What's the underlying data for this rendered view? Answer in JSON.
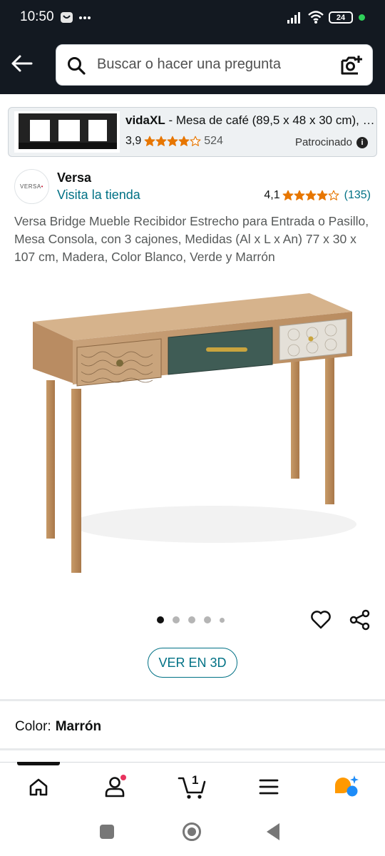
{
  "status_bar": {
    "time": "10:50",
    "battery": "24",
    "icons": [
      "notification-icon",
      "more-dots-icon",
      "signal-icon",
      "wifi-icon",
      "battery-icon",
      "status-dot-icon"
    ]
  },
  "search": {
    "placeholder": "Buscar o hacer una pregunta",
    "icons": [
      "back-arrow-icon",
      "search-icon",
      "camera-lens-icon"
    ]
  },
  "sponsored_ad": {
    "brand": "vidaXL",
    "title_rest": " - Mesa de café (89,5 x 48 x 30 cm), col...",
    "rating": "3,9",
    "stars": 3.9,
    "review_count": "524",
    "sponsored_label": "Patrocinado"
  },
  "brand": {
    "logo_text": "VERSA",
    "name": "Versa",
    "store_link": "Visita la tienda",
    "rating": "4,1",
    "stars": 4.1,
    "review_count": "(135)"
  },
  "product": {
    "title": "Versa Bridge Mueble Recibidor Estrecho para Entrada o Pasillo, Mesa Consola, con 3 cajones, Medidas (Al x L x An) 77 x 30 x 107 cm, Madera, Color Blanco, Verde y Marrón",
    "image_count": 5,
    "active_image": 0,
    "view_3d_label": "VER EN 3D"
  },
  "color": {
    "label": "Color:",
    "value": "Marrón"
  },
  "bottom_nav": {
    "items": [
      "home-icon",
      "account-icon",
      "cart-icon",
      "menu-icon",
      "rufus-icon"
    ],
    "cart_count": "1"
  },
  "colors": {
    "header_bg": "#131921",
    "link": "#007185",
    "star": "#e77600",
    "sponsored_bg": "#eef1f3"
  }
}
